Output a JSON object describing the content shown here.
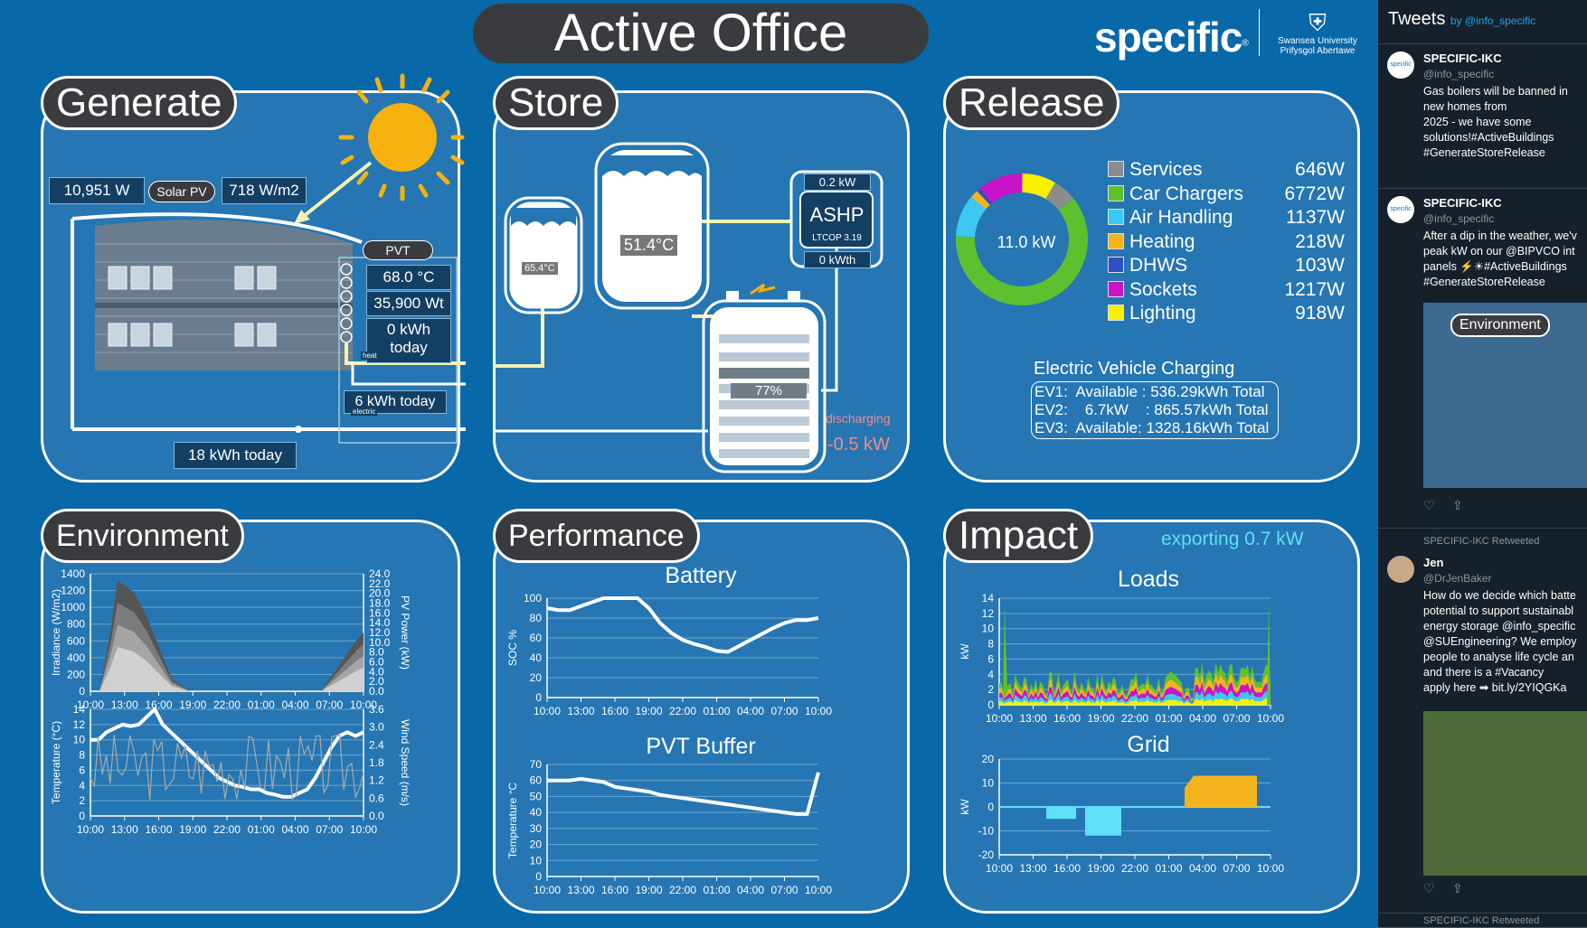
{
  "header": {
    "title": "Active Office",
    "brand": "specific",
    "brand_mark": "®",
    "university": "Swansea University\nPrifysgol Abertawe"
  },
  "generate": {
    "title": "Generate",
    "solar_power": "10,951 W",
    "solar_label": "Solar PV",
    "irradiance": "718 W/m2",
    "pvt_label": "PVT",
    "pvt_temp": "68.0 °C",
    "pvt_power": "35,900 Wt",
    "pvt_energy": "0 kWh\ntoday",
    "heat_tag": "heat",
    "electric_tag": "electric",
    "pvt_electric": "6 kWh today",
    "total_today": "18 kWh today"
  },
  "store": {
    "title": "Store",
    "tank_small_temp": "65.4°C",
    "tank_large_temp": "51.4°C",
    "ashp_label": "ASHP",
    "ashp_power": "0.2 kW",
    "ashp_cop": "LTCOP 3.19",
    "ashp_energy": "0 kWth",
    "battery_soc": "77%",
    "battery_state": "discharging",
    "battery_power": "-0.5 kW"
  },
  "release": {
    "title": "Release",
    "total": "11.0 kW",
    "legend": [
      {
        "label": "Services",
        "value": "646W",
        "color": "#8c8c8c"
      },
      {
        "label": "Car Chargers",
        "value": "6772W",
        "color": "#5dc12f"
      },
      {
        "label": "Air Handling",
        "value": "1137W",
        "color": "#3cc8f0"
      },
      {
        "label": "Heating",
        "value": "218W",
        "color": "#f5b41e"
      },
      {
        "label": "DHWS",
        "value": "103W",
        "color": "#2c4fc8"
      },
      {
        "label": "Sockets",
        "value": "1217W",
        "color": "#c814c8"
      },
      {
        "label": "Lighting",
        "value": "918W",
        "color": "#f8f000"
      }
    ],
    "ev_title": "Electric Vehicle Charging",
    "ev_rows": [
      "EV1:  Available : 536.29kWh Total",
      "EV2:    6.7kW    : 865.57kWh Total",
      "EV3:  Available: 1328.16kWh Total"
    ]
  },
  "environment": {
    "title": "Environment",
    "top_ylabel_left": "Irradiance (W/m2)",
    "top_ylabel_right": "PV Power (kW)",
    "top_yticks_left": [
      "1400",
      "1200",
      "1000",
      "800",
      "600",
      "400",
      "200",
      "0"
    ],
    "top_yticks_right": [
      "24.0",
      "22.0",
      "20.0",
      "18.0",
      "16.0",
      "14.0",
      "12.0",
      "10.0",
      "8.0",
      "6.0",
      "4.0",
      "2.0",
      "0.0"
    ],
    "bottom_ylabel_left": "Temperature (°C)",
    "bottom_ylabel_right": "Wind Speed (m/s)",
    "bottom_yticks_left": [
      "14",
      "12",
      "10",
      "8",
      "6",
      "4",
      "2",
      "0"
    ],
    "bottom_yticks_right": [
      "3.6",
      "3.0",
      "2.4",
      "1.8",
      "1.2",
      "0.6",
      "0.0"
    ],
    "xticks": [
      "10:00",
      "13:00",
      "16:00",
      "19:00",
      "22:00",
      "01:00",
      "04:00",
      "07:00",
      "10:00"
    ]
  },
  "performance": {
    "title": "Performance",
    "battery_title": "Battery",
    "battery_ylabel": "SOC %",
    "battery_yticks": [
      "100",
      "80",
      "60",
      "40",
      "20",
      "0"
    ],
    "pvt_title": "PVT Buffer",
    "pvt_ylabel": "Temperature °C",
    "pvt_yticks": [
      "70",
      "60",
      "50",
      "40",
      "30",
      "20",
      "10",
      "0"
    ],
    "xticks": [
      "10:00",
      "13:00",
      "16:00",
      "19:00",
      "22:00",
      "01:00",
      "04:00",
      "07:00",
      "10:00"
    ]
  },
  "impact": {
    "title": "Impact",
    "exporting": "exporting 0.7 kW",
    "loads_title": "Loads",
    "loads_ylabel": "kW",
    "loads_yticks": [
      "14",
      "12",
      "10",
      "8",
      "6",
      "4",
      "2",
      "0"
    ],
    "grid_title": "Grid",
    "grid_ylabel": "kW",
    "grid_yticks": [
      "20",
      "10",
      "0",
      "-10",
      "-20"
    ],
    "xticks": [
      "10:00",
      "13:00",
      "16:00",
      "19:00",
      "22:00",
      "01:00",
      "04:00",
      "07:00",
      "10:00"
    ]
  },
  "chart_data": [
    {
      "type": "line",
      "title": "Battery",
      "ylabel": "SOC %",
      "ylim": [
        0,
        100
      ],
      "x": [
        "10:00",
        "11:00",
        "12:00",
        "13:00",
        "14:00",
        "15:00",
        "16:00",
        "17:00",
        "18:00",
        "19:00",
        "20:00",
        "21:00",
        "22:00",
        "23:00",
        "00:00",
        "01:00",
        "02:00",
        "03:00",
        "04:00",
        "05:00",
        "06:00",
        "07:00",
        "08:00",
        "09:00",
        "10:00"
      ],
      "series": [
        {
          "values": [
            90,
            88,
            88,
            92,
            96,
            100,
            100,
            100,
            100,
            90,
            75,
            65,
            58,
            54,
            51,
            47,
            46,
            52,
            58,
            64,
            70,
            75,
            78,
            78,
            80
          ]
        }
      ]
    },
    {
      "type": "line",
      "title": "PVT Buffer",
      "ylabel": "Temperature °C",
      "ylim": [
        0,
        70
      ],
      "x": [
        "10:00",
        "11:00",
        "12:00",
        "13:00",
        "14:00",
        "15:00",
        "16:00",
        "17:00",
        "18:00",
        "19:00",
        "20:00",
        "21:00",
        "22:00",
        "23:00",
        "00:00",
        "01:00",
        "02:00",
        "03:00",
        "04:00",
        "05:00",
        "06:00",
        "07:00",
        "08:00",
        "09:00",
        "10:00"
      ],
      "series": [
        {
          "values": [
            60,
            60,
            60,
            61,
            60,
            59,
            56,
            55,
            54,
            53,
            51,
            50,
            49,
            48,
            47,
            46,
            45,
            44,
            43,
            42,
            41,
            40,
            39,
            39,
            65
          ]
        }
      ]
    },
    {
      "type": "area",
      "title": "Grid",
      "ylabel": "kW",
      "ylim": [
        -20,
        20
      ],
      "x": [
        "10:00",
        "13:00",
        "16:00",
        "17:00",
        "18:00",
        "19:00",
        "20:00",
        "22:00",
        "01:00",
        "04:00",
        "07:00",
        "10:00"
      ],
      "series": [
        {
          "values": [
            0,
            0,
            -5,
            0,
            -15,
            -15,
            0,
            0,
            12,
            12,
            0,
            0
          ]
        }
      ]
    },
    {
      "type": "area",
      "title": "Loads",
      "ylabel": "kW",
      "ylim": [
        0,
        14
      ],
      "x": [
        "10:00",
        "13:00",
        "16:00",
        "19:00",
        "22:00",
        "01:00",
        "04:00",
        "07:00",
        "10:00"
      ],
      "series": [
        {
          "values": [
            3,
            3,
            3,
            2,
            2,
            2,
            4,
            4,
            4
          ]
        }
      ]
    }
  ],
  "tweets": {
    "heading": "Tweets",
    "by": "by @info_specific",
    "items": [
      {
        "name": "SPECIFIC-IKC",
        "handle": "@info_specific",
        "avatar": "specific",
        "text": "Gas boilers will be banned in new homes from\n2025 - we have some\nsolutions!#ActiveBuildings\n#GenerateStoreRelease"
      },
      {
        "name": "SPECIFIC-IKC",
        "handle": "@info_specific",
        "avatar": "specific",
        "text": "After a dip in the weather, we'v\npeak kW on our @BIPVCO int\npanels ⚡☀#ActiveBuildings\n#GenerateStoreRelease",
        "image_label": "Environment"
      },
      {
        "retweet": "SPECIFIC-IKC Retweeted",
        "name": "Jen",
        "handle": "@DrJenBaker",
        "text": "How do we decide which batte\npotential to support sustainabl\nenergy storage @info_specific\n@SUEngineering? We employ\npeople to analyse life cycle an\nand there is a #Vacancy\napply here ➡ bit.ly/2YIQGKa"
      },
      {
        "retweet": "SPECIFIC-IKC Retweeted"
      }
    ]
  }
}
